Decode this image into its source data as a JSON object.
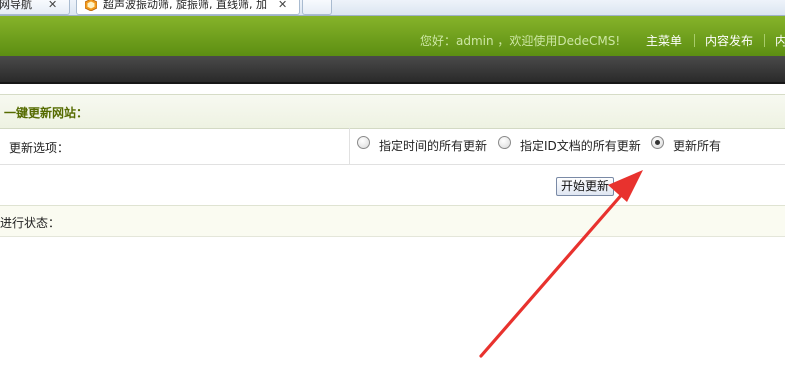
{
  "browser": {
    "tabs": [
      {
        "title": "网导航",
        "close": "✕"
      },
      {
        "title": "超声波振动筛, 旋振筛, 直线筛, 加",
        "close": "✕"
      },
      {
        "title": ""
      }
    ]
  },
  "header": {
    "welcome": "您好：admin ，欢迎使用DedeCMS!",
    "nav": [
      "主菜单",
      "内容发布",
      "内"
    ]
  },
  "panel": {
    "title": "一键更新网站：",
    "options_label": "更新选项：",
    "radio_options": [
      {
        "label": "指定时间的所有更新",
        "checked": false
      },
      {
        "label": "指定ID文档的所有更新",
        "checked": false
      },
      {
        "label": "更新所有",
        "checked": true
      }
    ],
    "start_button": "开始更新",
    "status_label": "进行状态："
  },
  "colors": {
    "header_green": "#6e9f1c",
    "title_text": "#556b00",
    "arrow": "#e8322e"
  },
  "icons": {
    "tab_favicon": "orange-box-icon",
    "annotation": "red-arrow"
  }
}
